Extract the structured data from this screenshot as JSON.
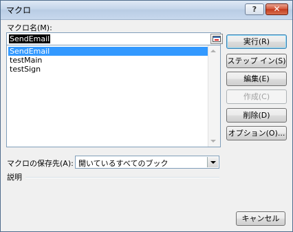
{
  "window": {
    "title": "マクロ",
    "help_glyph": "?",
    "close_glyph": "✕"
  },
  "macro_name": {
    "label": "マクロ名(M):",
    "value": "SendEmail"
  },
  "macro_list": {
    "items": [
      "SendEmail",
      "testMain",
      "testSign"
    ],
    "selected_index": 0
  },
  "buttons": {
    "run": "実行(R)",
    "step_into": "ステップ イン(S)",
    "edit": "編集(E)",
    "create": "作成(C)",
    "delete": "削除(D)",
    "options": "オプション(O)...",
    "cancel": "キャンセル"
  },
  "macros_in": {
    "label": "マクロの保存先(A):",
    "value": "開いているすべてのブック"
  },
  "description": {
    "label": "説明"
  },
  "colors": {
    "selection": "#3399ff",
    "dialog_bg": "#f0f0f0",
    "close_button": "#c23b1f"
  }
}
